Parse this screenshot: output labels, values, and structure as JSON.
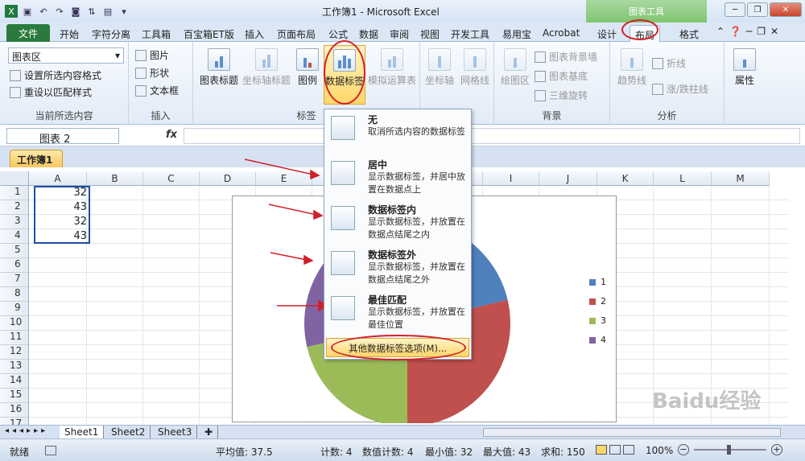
{
  "window": {
    "title": "工作簿1 - Microsoft Excel",
    "context_tools": "图表工具"
  },
  "tabs": [
    "文件",
    "开始",
    "字符分离",
    "工具箱",
    "百宝箱ET版",
    "插入",
    "页面布局",
    "公式",
    "数据",
    "审阅",
    "视图",
    "开发工具",
    "易用宝",
    "Acrobat",
    "设计",
    "布局",
    "格式"
  ],
  "active_tab": "布局",
  "ribbon": {
    "current_selection": {
      "dropdown": "图表区",
      "format_selection": "设置所选内容格式",
      "reset_style": "重设以匹配样式",
      "label": "当前所选内容"
    },
    "insert": {
      "picture": "图片",
      "shapes": "形状",
      "textbox": "文本框",
      "label": "插入"
    },
    "labels": {
      "chart_title": "图表标题",
      "axis_titles": "坐标轴标题",
      "legend": "图例",
      "data_labels": "数据标签",
      "data_table": "模拟运算表",
      "label": "标签"
    },
    "axes": {
      "axes": "坐标轴",
      "gridlines": "网格线",
      "label": "坐标轴"
    },
    "background": {
      "plot_area": "绘图区",
      "chart_wall": "图表背景墙",
      "chart_floor": "图表基底",
      "rotation": "三维旋转",
      "label": "背景"
    },
    "analysis": {
      "trendline": "趋势线",
      "lines": "折线",
      "updown": "涨/跌柱线",
      "label": "分析"
    },
    "properties": {
      "label": "属性"
    }
  },
  "formula_bar": {
    "name_box": "图表 2",
    "fx": "fx",
    "value": ""
  },
  "workbook_tab": "工作簿1",
  "columns": [
    "A",
    "B",
    "C",
    "D",
    "E",
    "F",
    "G",
    "H",
    "I",
    "J",
    "K",
    "L",
    "M"
  ],
  "rows": [
    "1",
    "2",
    "3",
    "4",
    "5",
    "6",
    "7",
    "8",
    "9",
    "10",
    "11",
    "12",
    "13",
    "14",
    "15",
    "16",
    "17"
  ],
  "cells": [
    "32",
    "43",
    "32",
    "43"
  ],
  "chart_data": {
    "type": "pie",
    "categories": [
      "1",
      "2",
      "3",
      "4"
    ],
    "values": [
      32,
      43,
      32,
      43
    ],
    "colors": [
      "#4f81bd",
      "#c0504d",
      "#9bbb59",
      "#8064a2"
    ],
    "legend": "right"
  },
  "menu": {
    "items": [
      {
        "title": "无",
        "desc": "取消所选内容的数据标签"
      },
      {
        "title": "居中",
        "desc": "显示数据标签，并居中放置在数据点上"
      },
      {
        "title": "数据标签内",
        "desc": "显示数据标签，并放置在数据点结尾之内"
      },
      {
        "title": "数据标签外",
        "desc": "显示数据标签，并放置在数据点结尾之外"
      },
      {
        "title": "最佳匹配",
        "desc": "显示数据标签，并放置在最佳位置"
      }
    ],
    "more": "其他数据标签选项(M)..."
  },
  "sheets": [
    "Sheet1",
    "Sheet2",
    "Sheet3"
  ],
  "status": {
    "ready": "就绪",
    "average": "平均值: 37.5",
    "count": "计数: 4",
    "numcount": "数值计数: 4",
    "min": "最小值: 32",
    "max": "最大值: 43",
    "sum": "求和: 150",
    "zoom": "100%"
  },
  "watermark": "Baidu经验"
}
